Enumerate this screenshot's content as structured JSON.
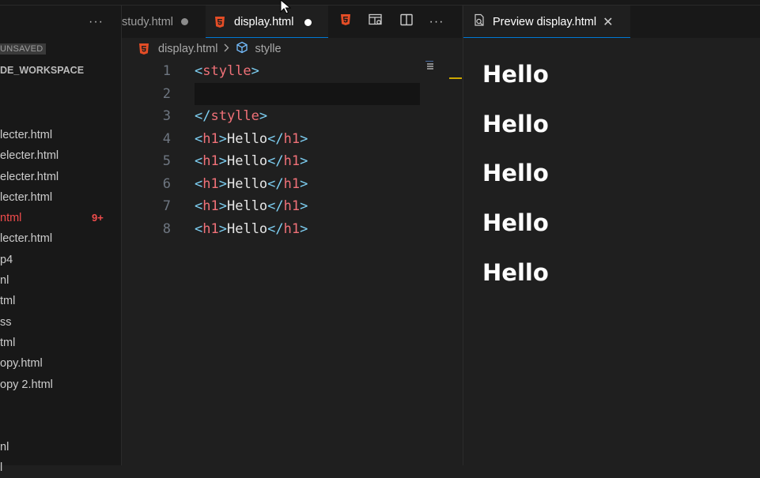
{
  "sidebar": {
    "more_label": "···",
    "unsaved_label": "UNSAVED",
    "workspace_label": "DE_WORKSPACE",
    "items": [
      {
        "label": "lecter.html",
        "error": false
      },
      {
        "label": "electer.html",
        "error": false
      },
      {
        "label": "electer.html",
        "error": false
      },
      {
        "label": "lecter.html",
        "error": false
      },
      {
        "label": "ntml",
        "error": true,
        "badge": "9+"
      },
      {
        "label": "lecter.html",
        "error": false
      },
      {
        "label": "p4",
        "error": false
      },
      {
        "label": "nl",
        "error": false
      },
      {
        "label": "tml",
        "error": false
      },
      {
        "label": "ss",
        "error": false
      },
      {
        "label": "tml",
        "error": false
      },
      {
        "label": "opy.html",
        "error": false
      },
      {
        "label": "opy 2.html",
        "error": false
      },
      {
        "label": "nl",
        "error": false
      },
      {
        "label": "l",
        "error": false
      }
    ]
  },
  "tabs": {
    "study": "study.html",
    "display": "display.html",
    "more": "···"
  },
  "breadcrumb": {
    "file": "display.html",
    "symbol": "stylle"
  },
  "editor": {
    "line_numbers": [
      "1",
      "2",
      "3",
      "4",
      "5",
      "6",
      "7",
      "8"
    ],
    "lines": [
      {
        "open": "<",
        "tag": "stylle",
        "close": ">",
        "text": "",
        "etag": ""
      },
      {
        "open": "",
        "tag": "",
        "close": "",
        "text": "",
        "etag": ""
      },
      {
        "open": "</",
        "tag": "stylle",
        "close": ">",
        "text": "",
        "etag": ""
      },
      {
        "open": "<",
        "tag": "h1",
        "close": ">",
        "text": "Hello",
        "etag": "h1"
      },
      {
        "open": "<",
        "tag": "h1",
        "close": ">",
        "text": "Hello",
        "etag": "h1"
      },
      {
        "open": "<",
        "tag": "h1",
        "close": ">",
        "text": "Hello",
        "etag": "h1"
      },
      {
        "open": "<",
        "tag": "h1",
        "close": ">",
        "text": "Hello",
        "etag": "h1"
      },
      {
        "open": "<",
        "tag": "h1",
        "close": ">",
        "text": "Hello",
        "etag": "h1"
      }
    ]
  },
  "preview": {
    "tab_label": "Preview display.html",
    "close": "✕",
    "headings": [
      "Hello",
      "Hello",
      "Hello",
      "Hello",
      "Hello"
    ]
  },
  "colors": {
    "accent": "#0078d4",
    "error": "#f14c4c",
    "tag": "#f07178",
    "bracket": "#7fd1f5",
    "html5_icon": "#e44d26"
  }
}
